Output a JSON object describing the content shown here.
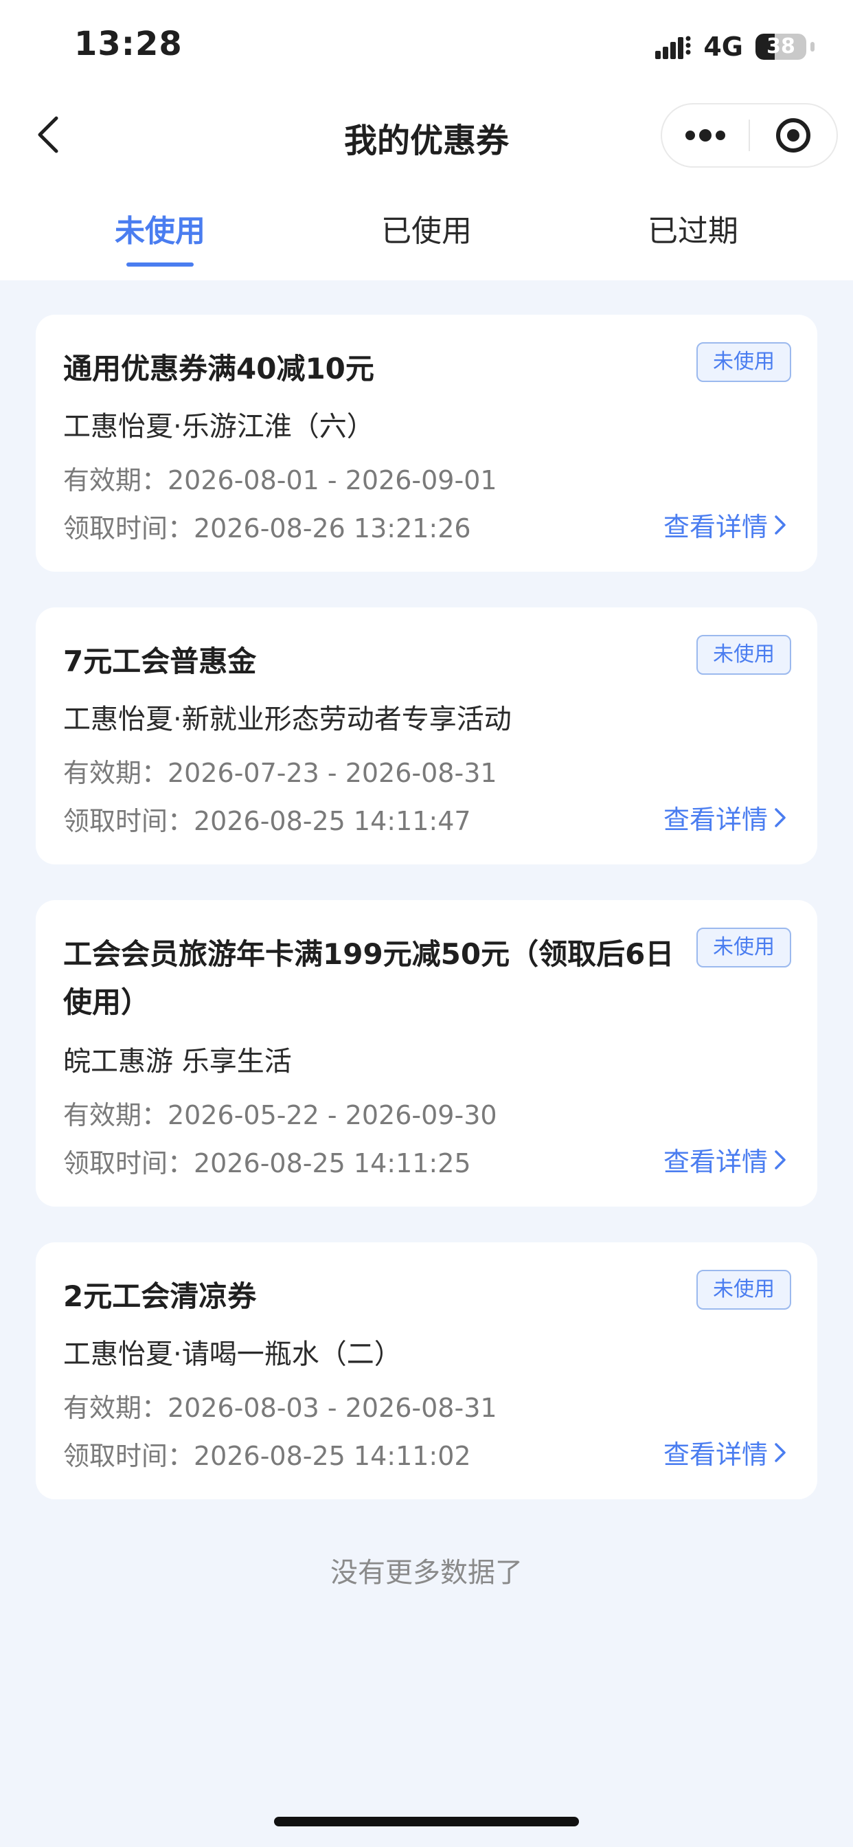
{
  "status_bar": {
    "time": "13:28",
    "network": "4G",
    "battery": "38",
    "battery_level": 0.38
  },
  "nav": {
    "title": "我的优惠券",
    "icons": [
      "chevron-left-icon",
      "more-dots-icon",
      "target-circle-icon"
    ]
  },
  "tabs": [
    {
      "label": "未使用",
      "active": true
    },
    {
      "label": "已使用",
      "active": false
    },
    {
      "label": "已过期",
      "active": false
    }
  ],
  "coupons": [
    {
      "title": "通用优惠券满40减10元",
      "status": "未使用",
      "activity": "工惠怡夏·乐游江淮（六）",
      "validity": "有效期：2026-08-01 - 2026-09-01",
      "received": "领取时间：2026-08-26 13:21:26",
      "details_label": "查看详情"
    },
    {
      "title": "7元工会普惠金",
      "status": "未使用",
      "activity": "工惠怡夏·新就业形态劳动者专享活动",
      "validity": "有效期：2026-07-23 - 2026-08-31",
      "received": "领取时间：2026-08-25 14:11:47",
      "details_label": "查看详情"
    },
    {
      "title": "工会会员旅游年卡满199元减50元（领取后6日使用）",
      "status": "未使用",
      "activity": "皖工惠游 乐享生活",
      "validity": "有效期：2026-05-22 - 2026-09-30",
      "received": "领取时间：2026-08-25 14:11:25",
      "details_label": "查看详情"
    },
    {
      "title": "2元工会清凉券",
      "status": "未使用",
      "activity": "工惠怡夏·请喝一瓶水（二）",
      "validity": "有效期：2026-08-03 - 2026-08-31",
      "received": "领取时间：2026-08-25 14:11:02",
      "details_label": "查看详情"
    }
  ],
  "footer": {
    "no_more": "没有更多数据了"
  },
  "colors": {
    "accent": "#4a7df0",
    "background": "#f1f5fc",
    "badge_bg": "#edf3fe",
    "badge_border": "#9bb9ee"
  }
}
